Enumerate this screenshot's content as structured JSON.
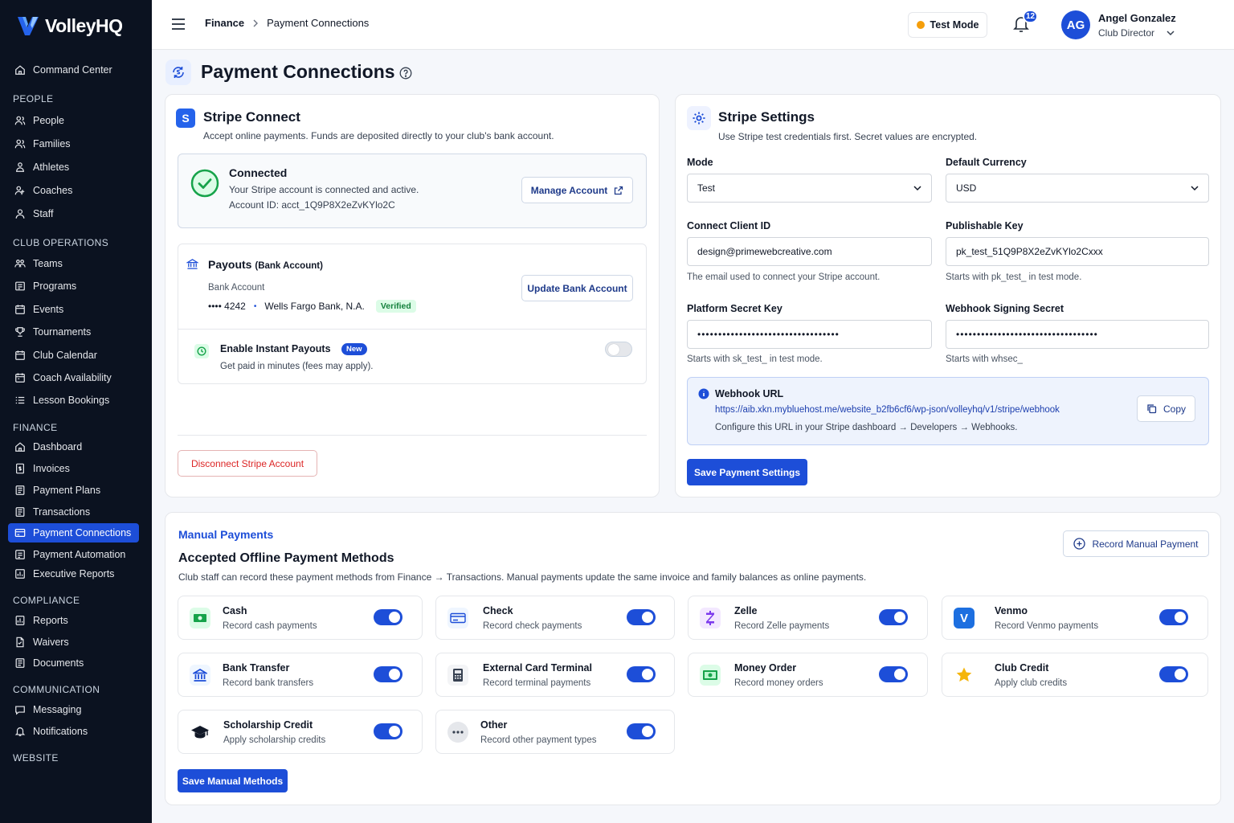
{
  "app": {
    "name": "VolleyHQ"
  },
  "sidebar": {
    "top_item": "Command Center",
    "sections": {
      "people": "PEOPLE",
      "club_operations": "CLUB OPERATIONS",
      "finance": "FINANCE",
      "compliance": "COMPLIANCE",
      "communication": "COMMUNICATION",
      "website": "WEBSITE"
    },
    "people": [
      "People",
      "Families",
      "Athletes",
      "Coaches",
      "Staff"
    ],
    "club_operations": [
      "Teams",
      "Programs",
      "Events",
      "Tournaments",
      "Club Calendar",
      "Coach Availability",
      "Lesson Bookings"
    ],
    "finance": [
      "Dashboard",
      "Invoices",
      "Payment Plans",
      "Transactions",
      "Payment Connections",
      "Payment Automation",
      "Executive Reports"
    ],
    "compliance": [
      "Reports",
      "Waivers",
      "Documents"
    ],
    "communication": [
      "Messaging",
      "Notifications"
    ],
    "active_item": "Payment Connections"
  },
  "header": {
    "breadcrumb": [
      "Finance",
      "Payment Connections"
    ],
    "test_mode_label": "Test Mode",
    "notification_count": "12",
    "user": {
      "initials": "AG",
      "name": "Angel Gonzalez",
      "role": "Club Director"
    }
  },
  "page": {
    "title": "Payment Connections"
  },
  "stripe_connect": {
    "title": "Stripe Connect",
    "subtitle": "Accept online payments. Funds are deposited directly to your club's bank account.",
    "status_title": "Connected",
    "status_text": "Your Stripe account is connected and active.",
    "account_id": "Account ID: acct_1Q9P8X2eZvKYlo2C",
    "manage_button": "Manage Account",
    "payouts": {
      "title": "Payouts",
      "title_suffix": "(Bank Account)",
      "bank_label": "Bank Account",
      "account_mask": "•••• 4242",
      "bank_name": "Wells Fargo Bank, N.A.",
      "verified_badge": "Verified",
      "update_button": "Update Bank Account"
    },
    "instant_payouts": {
      "title": "Enable Instant Payouts",
      "badge": "New",
      "subtitle": "Get paid in minutes (fees may apply).",
      "enabled": false
    },
    "disconnect_button": "Disconnect Stripe Account"
  },
  "stripe_settings": {
    "title": "Stripe Settings",
    "subtitle": "Use Stripe test credentials first. Secret values are encrypted.",
    "mode": {
      "label": "Mode",
      "value": "Test"
    },
    "currency": {
      "label": "Default Currency",
      "value": "USD"
    },
    "client_id": {
      "label": "Connect Client ID",
      "value": "design@primewebcreative.com",
      "hint": "The email used to connect your Stripe account."
    },
    "publishable_key": {
      "label": "Publishable Key",
      "value": "pk_test_51Q9P8X2eZvKYlo2Cxxx",
      "hint": "Starts with pk_test_ in test mode."
    },
    "secret_key": {
      "label": "Platform Secret Key",
      "value": "••••••••••••••••••••••••••••••••••",
      "hint": "Starts with sk_test_ in test mode."
    },
    "webhook_secret": {
      "label": "Webhook Signing Secret",
      "value": "••••••••••••••••••••••••••••••••••",
      "hint": "Starts with whsec_"
    },
    "webhook": {
      "title": "Webhook URL",
      "url": "https://aib.xkn.mybluehost.me/website_b2fb6cf6/wp-json/volleyhq/v1/stripe/webhook",
      "instructions": "Configure this URL in your Stripe dashboard → Developers → Webhooks.",
      "copy_button": "Copy"
    },
    "save_button": "Save Payment Settings"
  },
  "manual_payments": {
    "section_label": "Manual Payments",
    "title": "Accepted Offline Payment Methods",
    "description": "Club staff can record these payment methods from Finance → Transactions. Manual payments update the same invoice and family balances as online payments.",
    "record_button": "Record Manual Payment",
    "methods": [
      {
        "title": "Cash",
        "subtitle": "Record cash payments",
        "icon": "cash-icon",
        "enabled": true
      },
      {
        "title": "Check",
        "subtitle": "Record check payments",
        "icon": "check-icon",
        "enabled": true
      },
      {
        "title": "Zelle",
        "subtitle": "Record Zelle payments",
        "icon": "zelle-icon",
        "enabled": true
      },
      {
        "title": "Venmo",
        "subtitle": "Record Venmo payments",
        "icon": "venmo-icon",
        "enabled": true
      },
      {
        "title": "Bank Transfer",
        "subtitle": "Record bank transfers",
        "icon": "bank-icon",
        "enabled": true
      },
      {
        "title": "External Card Terminal",
        "subtitle": "Record terminal payments",
        "icon": "terminal-icon",
        "enabled": true
      },
      {
        "title": "Money Order",
        "subtitle": "Record money orders",
        "icon": "money-order-icon",
        "enabled": true
      },
      {
        "title": "Club Credit",
        "subtitle": "Apply club credits",
        "icon": "star-icon",
        "enabled": true
      },
      {
        "title": "Scholarship Credit",
        "subtitle": "Apply scholarship credits",
        "icon": "graduation-cap-icon",
        "enabled": true
      },
      {
        "title": "Other",
        "subtitle": "Record other payment types",
        "icon": "more-icon",
        "enabled": true
      }
    ],
    "save_button": "Save Manual Methods"
  },
  "colors": {
    "primary": "#1d4ed8",
    "sidebar": "#0b1220",
    "success": "#16a34a",
    "danger": "#dc2626",
    "warning": "#f59e0b"
  }
}
